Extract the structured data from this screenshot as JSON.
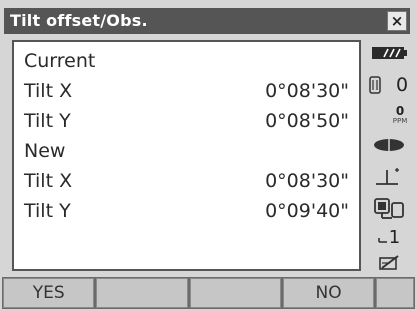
{
  "window": {
    "title": "Tilt offset/Obs.",
    "close_glyph": "×"
  },
  "panel": {
    "rows": [
      {
        "label": "Current",
        "value": ""
      },
      {
        "label": "Tilt X",
        "value": "0°08'30\""
      },
      {
        "label": "Tilt Y",
        "value": "0°08'50\""
      },
      {
        "label": "New",
        "value": ""
      },
      {
        "label": "Tilt X",
        "value": "0°08'30\""
      },
      {
        "label": "Tilt Y",
        "value": "0°09'40\""
      }
    ]
  },
  "status": {
    "battery_icon": "battery-icon",
    "prism_constant": "0",
    "ppm_value": "0",
    "ppm_unit": "PPM",
    "target_icon": "target-prism-icon",
    "tilt_icon": "tilt-compensation-icon",
    "comm_icon": "bluetooth-comm-icon",
    "input_mode": "1",
    "memo_icon": "memo-edit-icon"
  },
  "softkeys": [
    "YES",
    "",
    "",
    "NO",
    ""
  ]
}
